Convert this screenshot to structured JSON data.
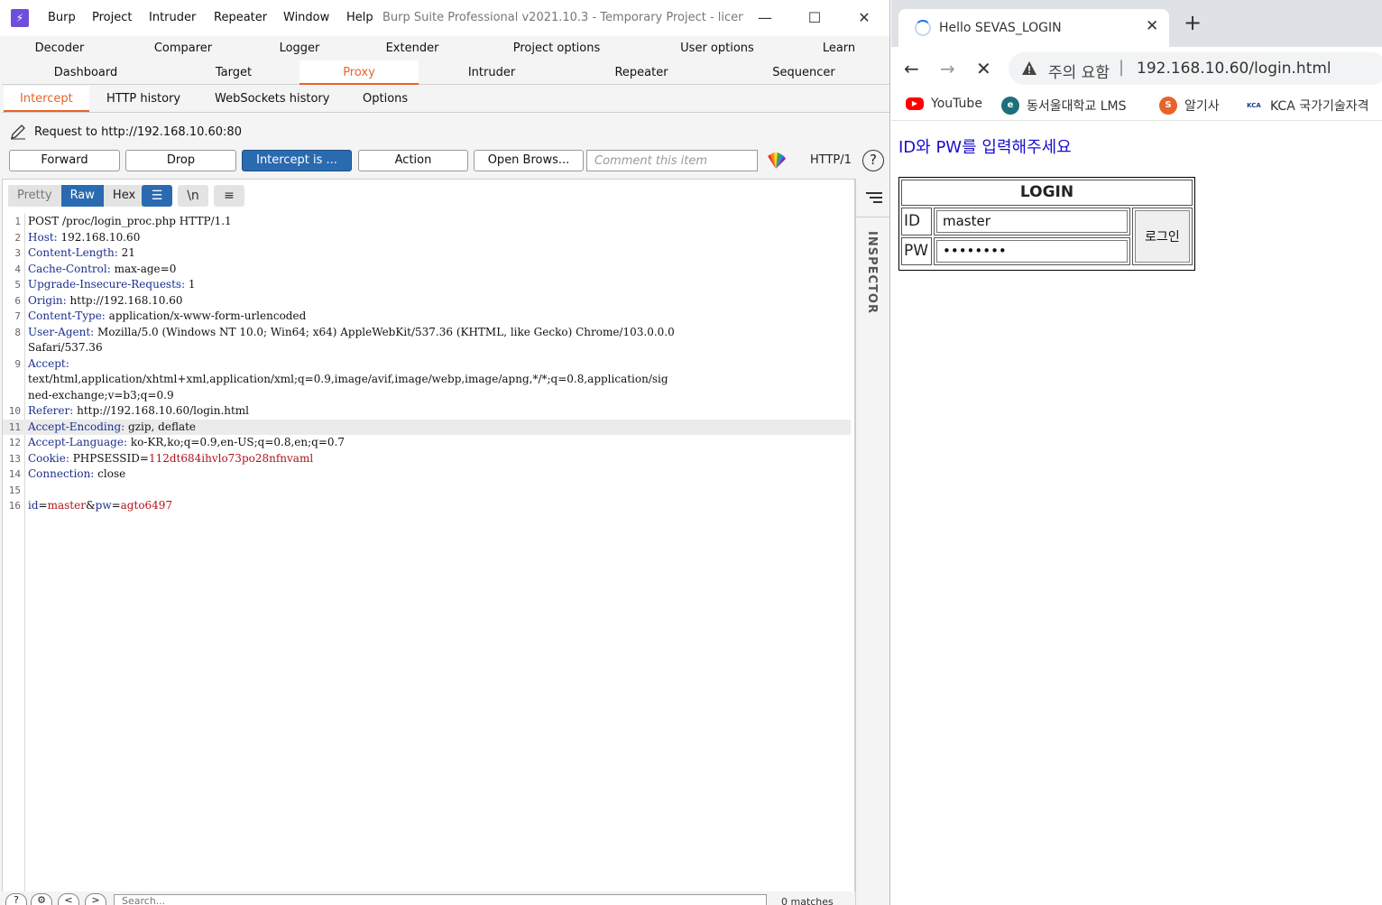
{
  "burp": {
    "menu": [
      "Burp",
      "Project",
      "Intruder",
      "Repeater",
      "Window",
      "Help"
    ],
    "title": "Burp Suite Professional v2021.10.3 - Temporary Project - licens...",
    "top_tabs_row1": [
      "Decoder",
      "Comparer",
      "Logger",
      "Extender",
      "Project options",
      "User options",
      "Learn"
    ],
    "top_tabs_row2": [
      "Dashboard",
      "Target",
      "Proxy",
      "Intruder",
      "Repeater",
      "Sequencer"
    ],
    "active_top_tab": "Proxy",
    "sub_tabs": [
      "Intercept",
      "HTTP history",
      "WebSockets history",
      "Options"
    ],
    "active_sub_tab": "Intercept",
    "request_to": "Request to http://192.168.10.60:80",
    "toolbar": {
      "forward": "Forward",
      "drop": "Drop",
      "intercept": "Intercept is ...",
      "action": "Action",
      "open_browser": "Open Brows...",
      "comment_placeholder": "Comment this item",
      "http_version": "HTTP/1"
    },
    "view_tabs": [
      "Pretty",
      "Raw",
      "Hex"
    ],
    "active_view": "Raw",
    "newline_toggle": "\\n",
    "request_lines": [
      {
        "n": "1",
        "key": "",
        "val": "POST /proc/login_proc.php HTTP/1.1"
      },
      {
        "n": "2",
        "key": "Host:",
        "val": " 192.168.10.60"
      },
      {
        "n": "3",
        "key": "Content-Length:",
        "val": " 21"
      },
      {
        "n": "4",
        "key": "Cache-Control:",
        "val": " max-age=0"
      },
      {
        "n": "5",
        "key": "Upgrade-Insecure-Requests:",
        "val": " 1"
      },
      {
        "n": "6",
        "key": "Origin:",
        "val": " http://192.168.10.60"
      },
      {
        "n": "7",
        "key": "Content-Type:",
        "val": " application/x-www-form-urlencoded"
      },
      {
        "n": "8",
        "key": "User-Agent:",
        "val": " Mozilla/5.0 (Windows NT 10.0; Win64; x64) AppleWebKit/537.36 (KHTML, like Gecko) Chrome/103.0.0.0"
      },
      {
        "n": "",
        "key": "",
        "val": "Safari/537.36"
      },
      {
        "n": "9",
        "key": "Accept:",
        "val": ""
      },
      {
        "n": "",
        "key": "",
        "val": "text/html,application/xhtml+xml,application/xml;q=0.9,image/avif,image/webp,image/apng,*/*;q=0.8,application/sig"
      },
      {
        "n": "",
        "key": "",
        "val": "ned-exchange;v=b3;q=0.9"
      },
      {
        "n": "10",
        "key": "Referer:",
        "val": " http://192.168.10.60/login.html"
      },
      {
        "n": "11",
        "key": "Accept-Encoding:",
        "val": " gzip, deflate"
      },
      {
        "n": "12",
        "key": "Accept-Language:",
        "val": " ko-KR,ko;q=0.9,en-US;q=0.8,en;q=0.7"
      },
      {
        "n": "13",
        "key": "Cookie:",
        "val": " PHPSESSID=",
        "cookie": "112dt684ihvlo73po28nfnvaml"
      },
      {
        "n": "14",
        "key": "Connection:",
        "val": " close"
      },
      {
        "n": "15",
        "key": "",
        "val": ""
      },
      {
        "n": "16",
        "key": "",
        "val": "",
        "body": true
      }
    ],
    "highlighted_line": "11",
    "body_params": {
      "id_key": "id",
      "id_val": "master",
      "pw_key": "pw",
      "pw_val": "agto6497"
    },
    "search_placeholder": "Search...",
    "matches": "0 matches",
    "inspector_label": "INSPECTOR",
    "colors": {
      "accent": "#e8632b",
      "primary_button": "#2a6ab0",
      "header_key": "#1b2f8f",
      "value_red": "#b0131b"
    }
  },
  "chrome": {
    "tab_title": "Hello SEVAS_LOGIN",
    "warning": "주의 요함",
    "url": "192.168.10.60/login.html",
    "bookmarks": [
      {
        "label": "YouTube",
        "icon": "youtube-icon"
      },
      {
        "label": "동서울대학교 LMS",
        "icon": "lms-icon"
      },
      {
        "label": "알기사",
        "icon": "algisa-icon"
      },
      {
        "label": "KCA 국가기술자격",
        "icon": "kca-icon"
      }
    ],
    "page": {
      "instruction": "ID와 PW를 입력해주세요",
      "login_header": "LOGIN",
      "id_label": "ID",
      "pw_label": "PW",
      "id_value": "master",
      "pw_value": "••••••••",
      "login_button": "로그인"
    }
  }
}
